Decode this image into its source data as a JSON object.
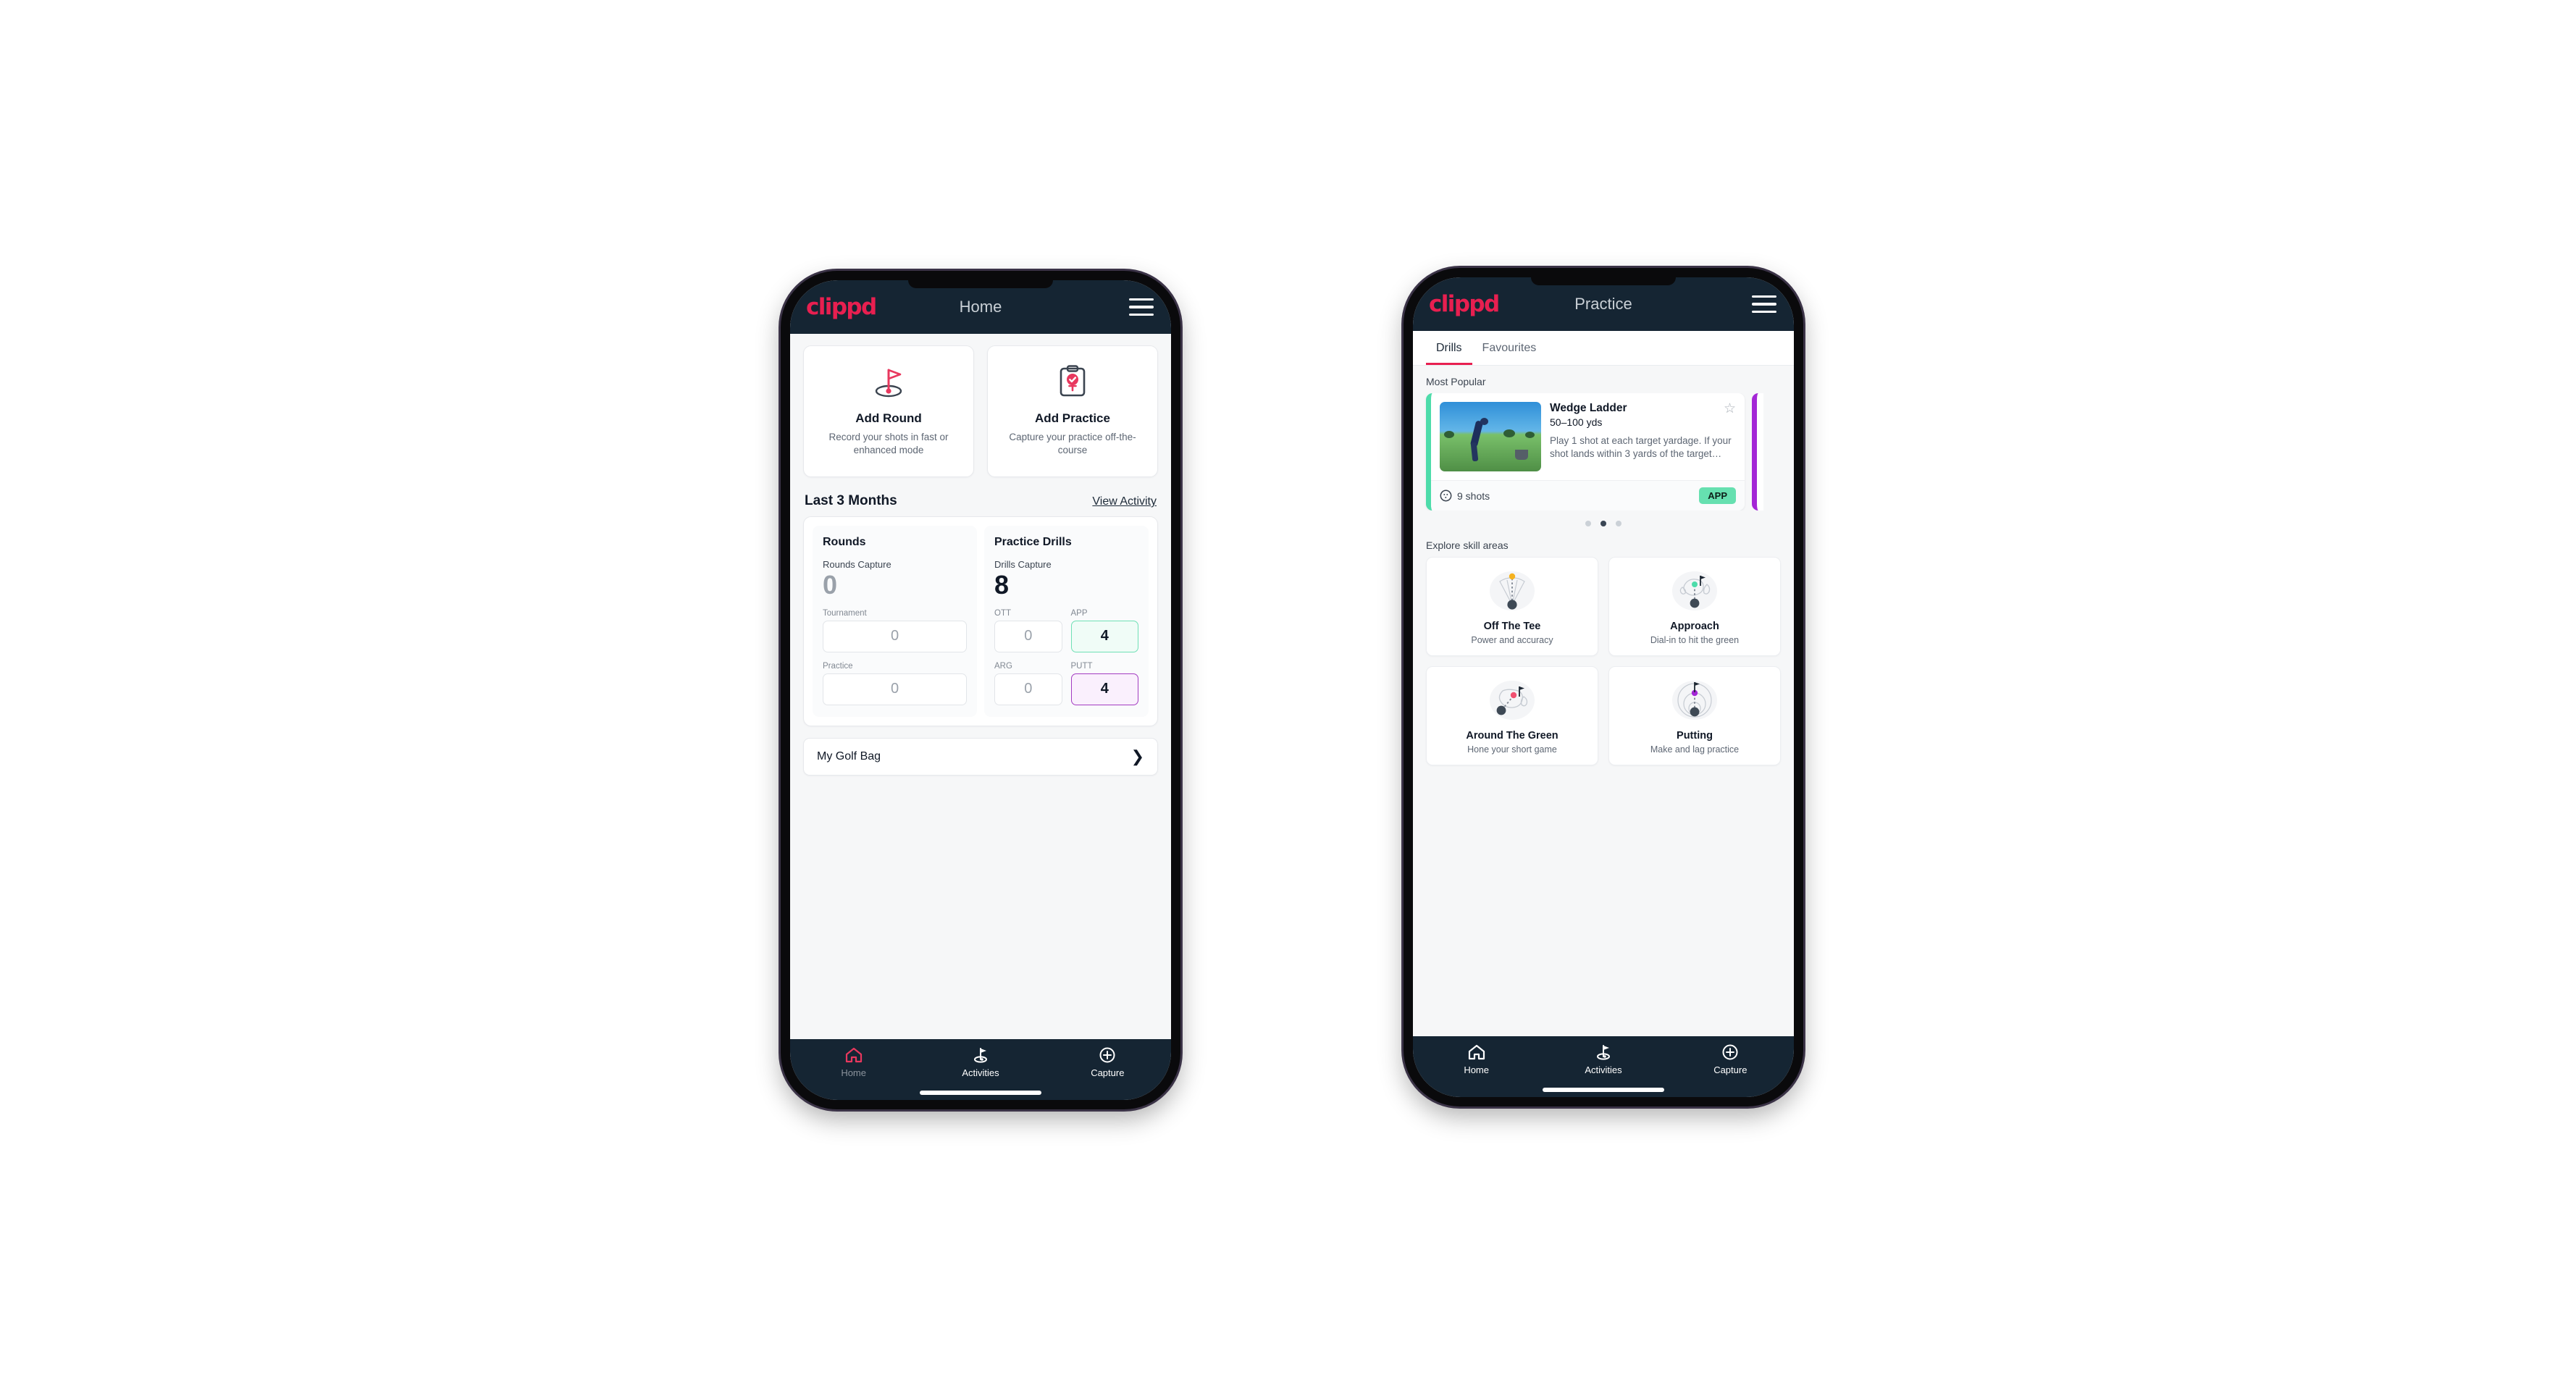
{
  "colors": {
    "brand_pink": "#e81f50",
    "navy": "#152533",
    "app_green": "#66e0b0",
    "putt_purple": "#a33bc2",
    "ott_yellow": "#f5b21f",
    "arg_pink": "#f05070"
  },
  "phone_home": {
    "appbar": {
      "logo": "clippd",
      "title": "Home",
      "menu_icon": "hamburger-icon"
    },
    "actions": [
      {
        "icon": "golf-flag-hole-icon",
        "title": "Add Round",
        "subtitle": "Record your shots in fast or enhanced mode"
      },
      {
        "icon": "clipboard-check-tee-icon",
        "title": "Add Practice",
        "subtitle": "Capture your practice off-the-course"
      }
    ],
    "section": {
      "title": "Last 3 Months",
      "link": "View Activity"
    },
    "stats": {
      "rounds": {
        "heading": "Rounds",
        "capture_label": "Rounds Capture",
        "capture_value": "0",
        "fields": [
          {
            "label": "Tournament",
            "value": "0",
            "state": "empty"
          },
          {
            "label": "Practice",
            "value": "0",
            "state": "empty"
          }
        ]
      },
      "drills": {
        "heading": "Practice Drills",
        "capture_label": "Drills Capture",
        "capture_value": "8",
        "fields": [
          {
            "label": "OTT",
            "value": "0",
            "state": "empty"
          },
          {
            "label": "APP",
            "value": "4",
            "state": "app"
          },
          {
            "label": "ARG",
            "value": "0",
            "state": "empty"
          },
          {
            "label": "PUTT",
            "value": "4",
            "state": "putt"
          }
        ]
      }
    },
    "golf_bag": {
      "label": "My Golf Bag",
      "chevron": "chevron-right-icon"
    },
    "bottom_nav": [
      {
        "icon": "home-icon",
        "label": "Home",
        "active": true
      },
      {
        "icon": "golf-flag-icon",
        "label": "Activities",
        "active": false
      },
      {
        "icon": "plus-circle-icon",
        "label": "Capture",
        "active": false
      }
    ]
  },
  "phone_practice": {
    "appbar": {
      "logo": "clippd",
      "title": "Practice",
      "menu_icon": "hamburger-icon"
    },
    "tabs": [
      {
        "label": "Drills",
        "active": true
      },
      {
        "label": "Favourites",
        "active": false
      }
    ],
    "most_popular_label": "Most Popular",
    "drill_card": {
      "title": "Wedge Ladder",
      "yardage": "50–100 yds",
      "description": "Play 1 shot at each target yardage. If your shot lands within 3 yards of the target…",
      "shots_icon": "golf-ball-icon",
      "shots": "9 shots",
      "badge": "APP",
      "star_icon": "star-outline-icon",
      "thumbnail": "golfer-chipping-photo"
    },
    "carousel_dots": {
      "count": 3,
      "active_index": 1
    },
    "explore_label": "Explore skill areas",
    "skill_areas": [
      {
        "icon": "tee-shot-fan-icon",
        "name": "Off The Tee",
        "subtitle": "Power and accuracy"
      },
      {
        "icon": "approach-green-icon",
        "name": "Approach",
        "subtitle": "Dial-in to hit the green"
      },
      {
        "icon": "around-green-icon",
        "name": "Around The Green",
        "subtitle": "Hone your short game"
      },
      {
        "icon": "putting-rings-icon",
        "name": "Putting",
        "subtitle": "Make and lag practice"
      }
    ],
    "bottom_nav": [
      {
        "icon": "home-icon",
        "label": "Home",
        "active": false
      },
      {
        "icon": "golf-flag-icon",
        "label": "Activities",
        "active": true
      },
      {
        "icon": "plus-circle-icon",
        "label": "Capture",
        "active": false
      }
    ]
  }
}
